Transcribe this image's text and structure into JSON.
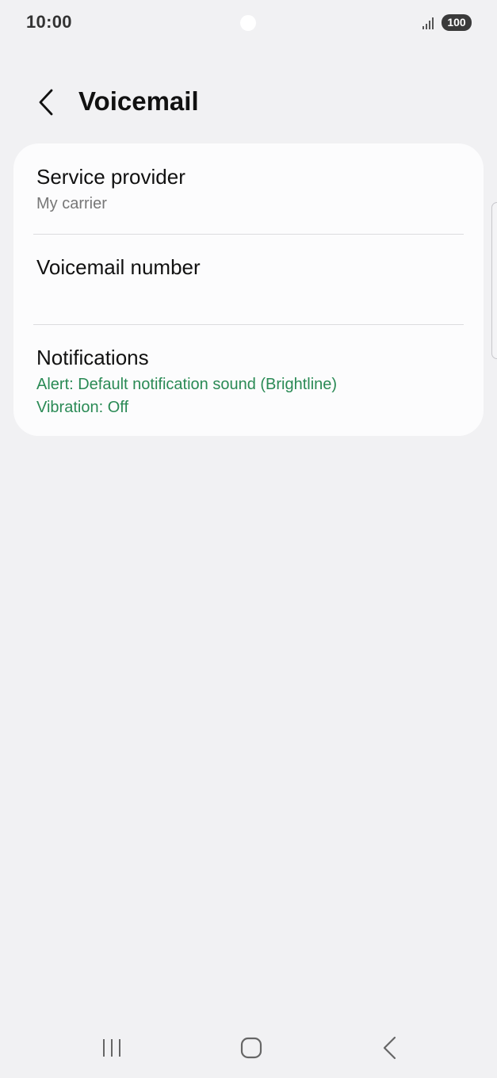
{
  "status_bar": {
    "time": "10:00",
    "battery": "100",
    "signal_icon": "signal-bars-icon"
  },
  "header": {
    "back_icon": "chevron-left-icon",
    "title": "Voicemail"
  },
  "settings": {
    "service_provider": {
      "title": "Service provider",
      "subtitle": "My carrier"
    },
    "voicemail_number": {
      "title": "Voicemail number"
    },
    "notifications": {
      "title": "Notifications",
      "alert": "Alert: Default notification sound (Brightline)",
      "vibration": "Vibration: Off"
    }
  },
  "colors": {
    "background": "#f1f1f3",
    "card": "#fcfcfd",
    "accent_green": "#2a8a55",
    "subtitle_gray": "#777777"
  },
  "nav_bar": {
    "recents_icon": "recents-icon",
    "home_icon": "home-icon",
    "back_icon": "back-chevron-icon"
  }
}
